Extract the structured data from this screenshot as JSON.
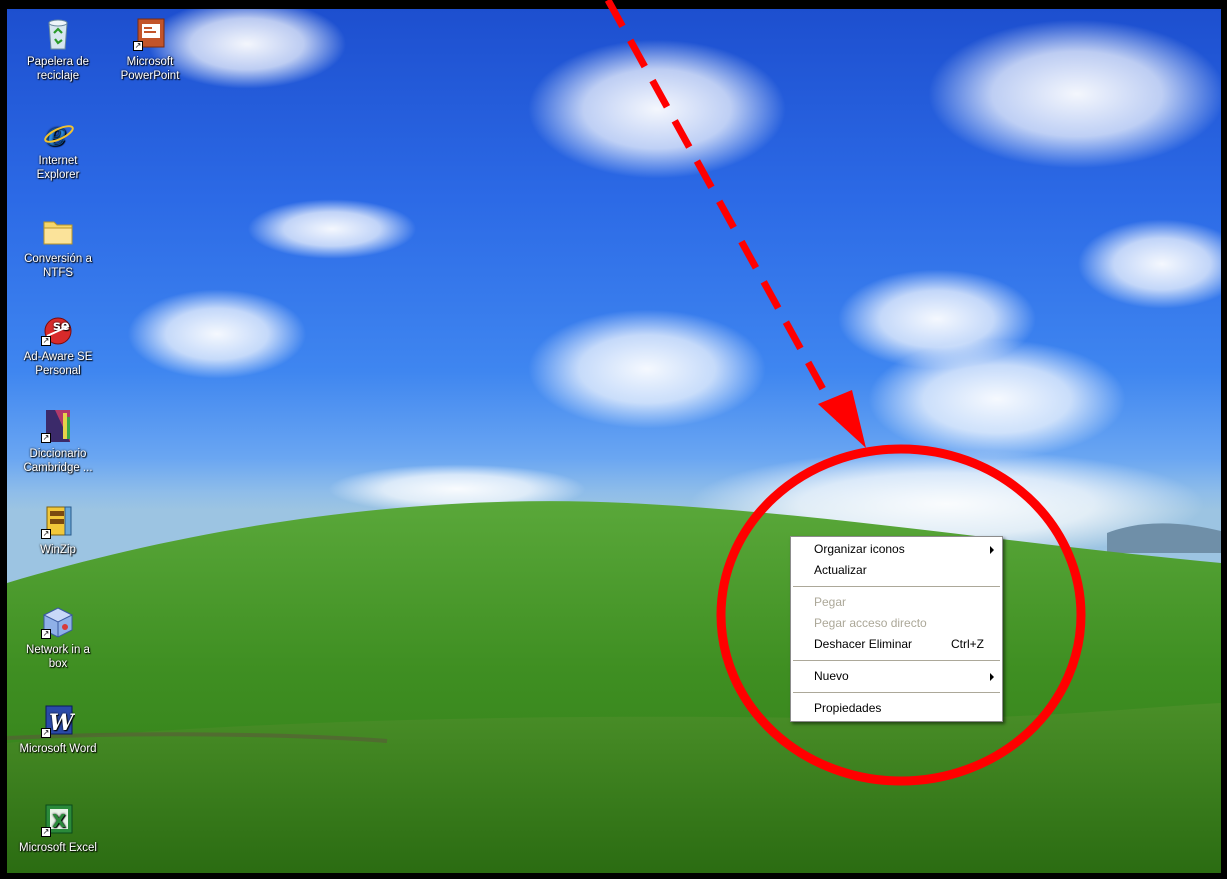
{
  "desktop": {
    "icons": [
      {
        "label_line1": "Papelera de",
        "label_line2": "reciclaje",
        "icon": "recycle-bin-icon"
      },
      {
        "label_line1": "Microsoft",
        "label_line2": "PowerPoint",
        "icon": "powerpoint-icon"
      },
      {
        "label_line1": "Internet",
        "label_line2": "Explorer",
        "icon": "internet-explorer-icon"
      },
      {
        "label_line1": "Conversión a",
        "label_line2": "NTFS",
        "icon": "folder-icon"
      },
      {
        "label_line1": "Ad-Aware SE",
        "label_line2": "Personal",
        "icon": "adaware-icon"
      },
      {
        "label_line1": "Diccionario",
        "label_line2": "Cambridge ...",
        "icon": "cambridge-dictionary-icon"
      },
      {
        "label_line1": "WinZip",
        "label_line2": "",
        "icon": "winzip-icon"
      },
      {
        "label_line1": "Network in a",
        "label_line2": "box",
        "icon": "network-box-icon"
      },
      {
        "label_line1": "Microsoft Word",
        "label_line2": "",
        "icon": "word-icon"
      },
      {
        "label_line1": "Microsoft Excel",
        "label_line2": "",
        "icon": "excel-icon"
      }
    ]
  },
  "context_menu": {
    "arrange_icons": "Organizar iconos",
    "refresh": "Actualizar",
    "paste": "Pegar",
    "paste_shortcut": "Pegar acceso directo",
    "undo_delete": "Deshacer Eliminar",
    "undo_delete_accel": "Ctrl+Z",
    "new": "Nuevo",
    "properties": "Propiedades"
  },
  "annotation": {
    "color": "#ff0000"
  }
}
